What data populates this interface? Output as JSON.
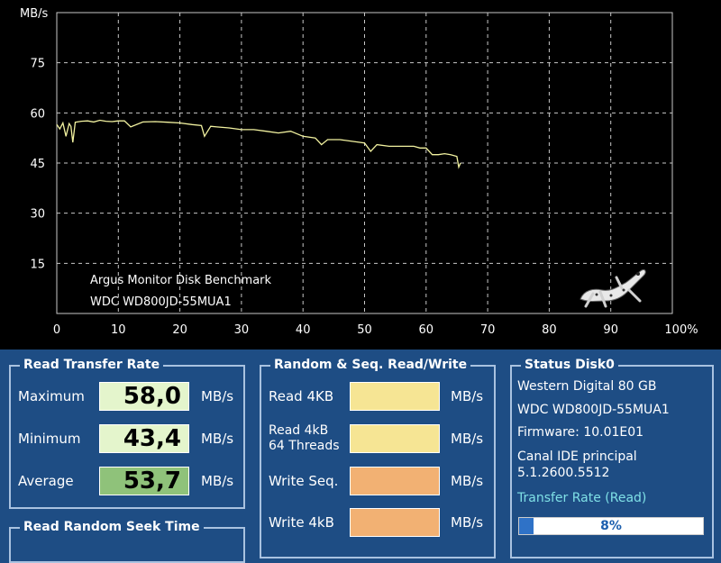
{
  "chart_data": {
    "type": "line",
    "ylabel": "MB/s",
    "yticks": [
      15,
      30,
      45,
      60,
      75
    ],
    "xticks": [
      "0",
      "10",
      "20",
      "30",
      "40",
      "50",
      "60",
      "70",
      "80",
      "90",
      "100%"
    ],
    "xlim": [
      0,
      100
    ],
    "ylim": [
      0,
      90
    ],
    "grid": true,
    "color": "#f2f2a0",
    "annotations": [
      "Argus Monitor Disk Benchmark",
      "WDC WD800JD-55MUA1"
    ],
    "series": [
      {
        "x": [
          0,
          0.5,
          1,
          1.5,
          2,
          2.3,
          2.6,
          3,
          4,
          5,
          6,
          7,
          8,
          9,
          10,
          11,
          12,
          14,
          16,
          18,
          20,
          22,
          23.5,
          24,
          25,
          26,
          28,
          30,
          32,
          34,
          36,
          38,
          40,
          42,
          43,
          44,
          46,
          48,
          50,
          51,
          52,
          54,
          56,
          58,
          59,
          60,
          61,
          62,
          63,
          64,
          65,
          65.3,
          65.6
        ],
        "y": [
          56.5,
          55.2,
          57.0,
          53.0,
          56.8,
          56.0,
          51.2,
          57.2,
          57.5,
          57.6,
          57.3,
          57.8,
          57.5,
          57.4,
          57.6,
          57.6,
          55.8,
          57.3,
          57.4,
          57.2,
          57.0,
          56.5,
          56.2,
          53.0,
          56.0,
          55.8,
          55.5,
          55.0,
          55.0,
          54.5,
          54.0,
          54.5,
          53.0,
          52.5,
          50.5,
          52.0,
          52.0,
          51.5,
          51.0,
          48.5,
          50.5,
          50.0,
          50.0,
          50.0,
          49.5,
          49.5,
          47.5,
          47.5,
          47.8,
          47.5,
          47.0,
          43.8,
          45.0
        ]
      }
    ]
  },
  "read_transfer": {
    "title": "Read Transfer Rate",
    "rows": [
      {
        "label": "Maximum",
        "value": "58,0",
        "unit": "MB/s",
        "bg": "#e4f5cc"
      },
      {
        "label": "Minimum",
        "value": "43,4",
        "unit": "MB/s",
        "bg": "#e4f5cc"
      },
      {
        "label": "Average",
        "value": "53,7",
        "unit": "MB/s",
        "bg": "#8fc27a"
      }
    ]
  },
  "random_seq": {
    "title": "Random & Seq. Read/Write",
    "rows": [
      {
        "label": "Read 4KB",
        "sublabel": "",
        "unit": "MB/s",
        "color": "#f6e594"
      },
      {
        "label": "Read 4kB",
        "sublabel": "64 Threads",
        "unit": "MB/s",
        "color": "#f6e594"
      },
      {
        "label": "Write Seq.",
        "sublabel": "",
        "unit": "MB/s",
        "color": "#f2b173"
      },
      {
        "label": "Write 4kB",
        "sublabel": "",
        "unit": "MB/s",
        "color": "#f2b173"
      }
    ]
  },
  "status": {
    "title": "Status Disk0",
    "lines": [
      "Western Digital 80 GB",
      "WDC WD800JD-55MUA1",
      "Firmware: 10.01E01",
      "Canal IDE principal",
      "5.1.2600.5512"
    ],
    "transfer_label": "Transfer Rate (Read)",
    "progress_text": "8%",
    "progress_value": 0.08,
    "transfer_label_color": "#7fe0e6"
  },
  "seek": {
    "title": "Read Random Seek Time"
  }
}
